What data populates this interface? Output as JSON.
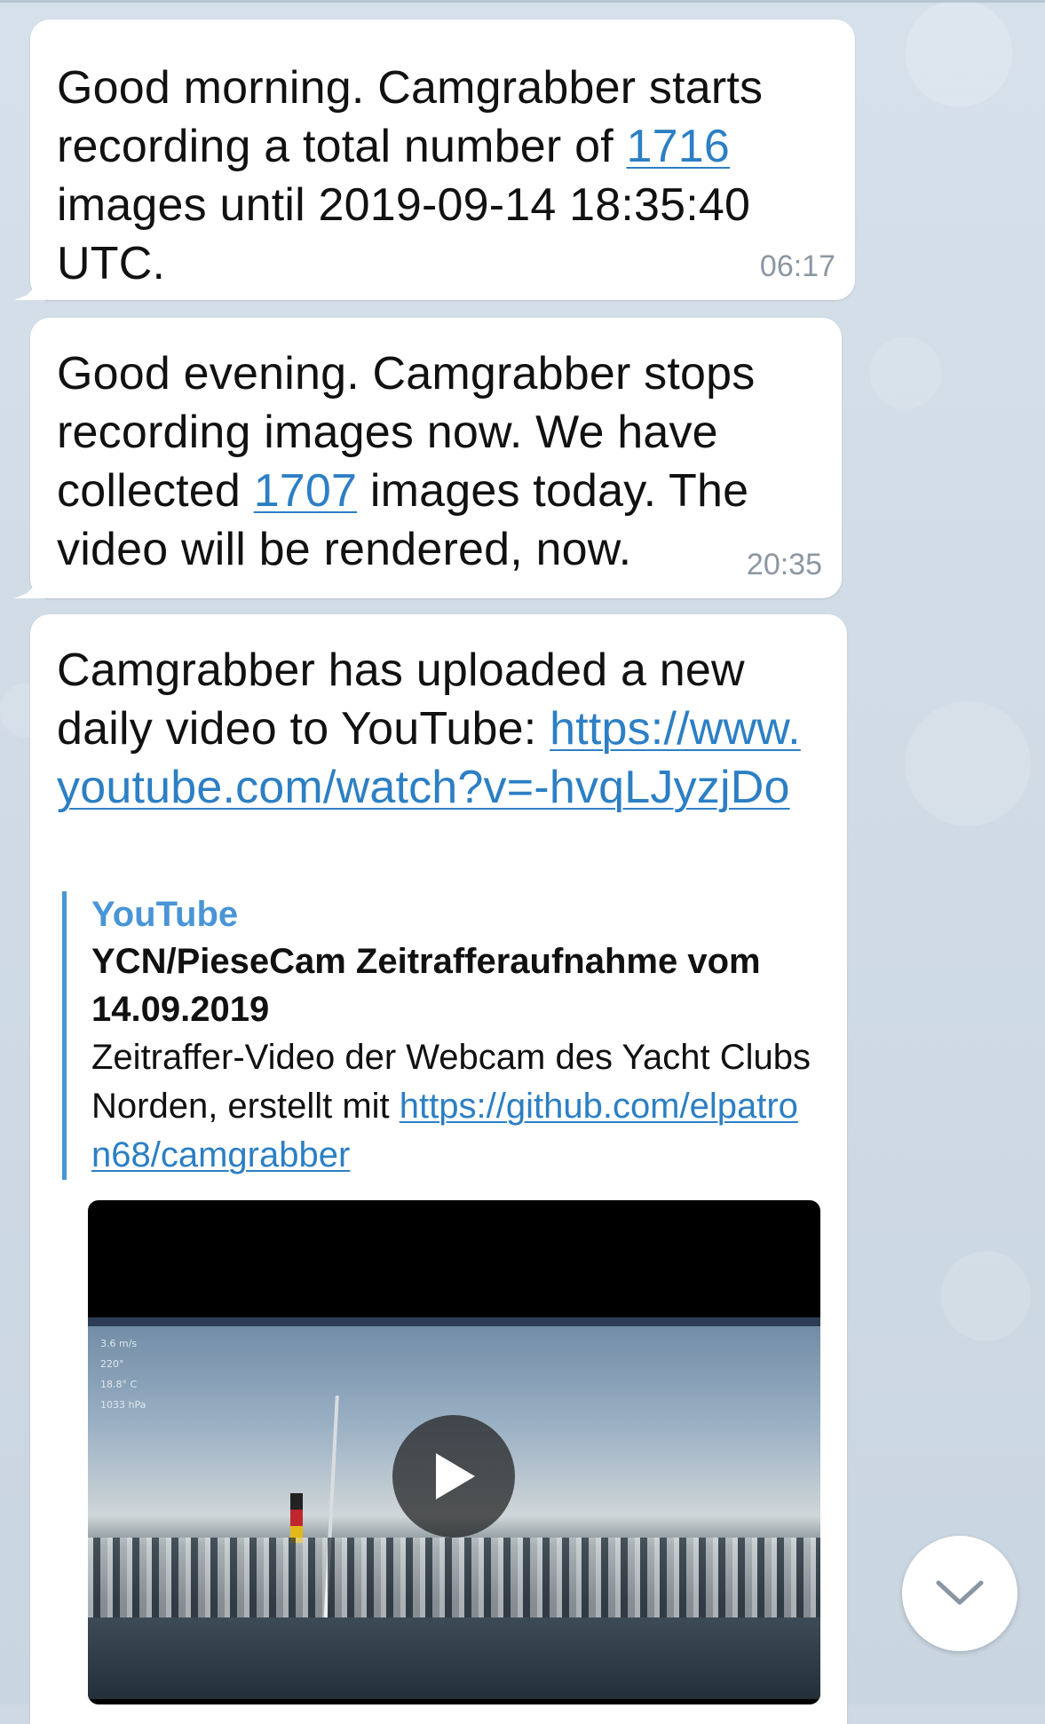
{
  "messages": [
    {
      "text_before": "Good morning. Camgrabber starts recording a total number of ",
      "link": "1716",
      "text_after": " images until 2019-09-14 18:35:40 UTC.",
      "time": "06:17"
    },
    {
      "text_before": "Good evening. Camgrabber stops recording images now. We have collected ",
      "link": "1707",
      "text_after": " images today. The video will be rendered, now.",
      "time": "20:35"
    },
    {
      "text_before": "Camgrabber has uploaded a new daily video to YouTube: ",
      "link": "https://www.youtube.com/watch?v=-hvqLJyzjDo"
    }
  ],
  "preview": {
    "site": "YouTube",
    "title": "YCN/PieseCam Zeitrafferaufnahme vom 14.09.2019",
    "desc_before": "Zeitraffer-Video der Webcam des Yacht Clubs Norden, erstellt mit ",
    "desc_link": "https://github.com/elpatron68/camgrabber"
  },
  "video": {
    "overlay": [
      "3.6 m/s",
      "220°",
      "18.8° C",
      "1033 hPa"
    ],
    "play_icon": "play-icon"
  },
  "scroll_button_icon": "chevron-down-icon",
  "colors": {
    "link": "#2c7fc4",
    "accent": "#4a95d6",
    "time": "#8c97a1",
    "background": "#cfd9e3"
  }
}
